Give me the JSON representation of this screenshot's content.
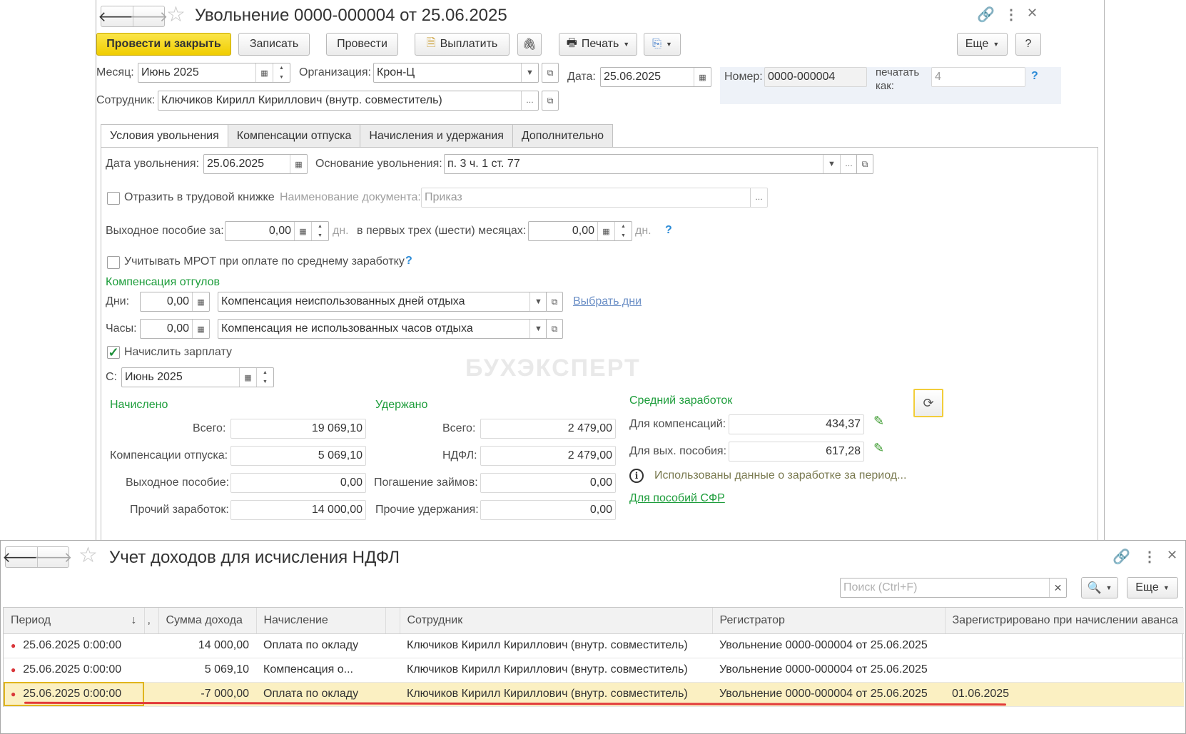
{
  "doc": {
    "title": "Увольнение 0000-000004 от 25.06.2025",
    "toolbar": {
      "post_close": "Провести и закрыть",
      "save": "Записать",
      "post": "Провести",
      "pay": "Выплатить",
      "print": "Печать",
      "more": "Еще",
      "help": "?"
    },
    "header": {
      "month_label": "Месяц:",
      "month_value": "Июнь 2025",
      "org_label": "Организация:",
      "org_value": "Крон-Ц",
      "date_label": "Дата:",
      "date_value": "25.06.2025",
      "number_label": "Номер:",
      "number_value": "0000-000004",
      "print_as_label_1": "печатать",
      "print_as_label_2": "как:",
      "print_as_value": "4",
      "print_as_help": "?",
      "employee_label": "Сотрудник:",
      "employee_value": "Ключиков Кирилл Кириллович (внутр. совместитель)"
    },
    "tabs": [
      "Условия увольнения",
      "Компенсации отпуска",
      "Начисления и удержания",
      "Дополнительно"
    ],
    "conditions": {
      "dismissal_date_label": "Дата увольнения:",
      "dismissal_date_value": "25.06.2025",
      "basis_label": "Основание увольнения:",
      "basis_value": "п. 3 ч. 1 ст. 77",
      "workbook_label": "Отразить в трудовой книжке",
      "workbook_checked": false,
      "doc_name_label": "Наименование документа:",
      "doc_name_value": "Приказ",
      "severance_label": "Выходное пособие за:",
      "severance_value": "0,00",
      "days_unit": "дн.",
      "first_months_label": "в первых трех (шести) месяцах:",
      "first_months_value": "0,00",
      "help": "?",
      "mrot_label": "Учитывать МРОТ при оплате по среднему заработку",
      "mrot_checked": false,
      "comp_section": "Компенсация отгулов",
      "days_label": "Дни:",
      "days_value": "0,00",
      "days_type": "Компенсация неиспользованных дней отдыха",
      "choose_days": "Выбрать дни",
      "hours_label": "Часы:",
      "hours_value": "0,00",
      "hours_type": "Компенсация не использованных часов отдыха",
      "accrue_label": "Начислить зарплату",
      "accrue_checked": true,
      "from_label": "С:",
      "from_value": "Июнь 2025"
    },
    "accrued": {
      "title": "Начислено",
      "total_label": "Всего:",
      "total": "19 069,10",
      "vacation_comp_label": "Компенсации отпуска:",
      "vacation_comp": "5 069,10",
      "severance_label": "Выходное пособие:",
      "severance": "0,00",
      "other_label": "Прочий заработок:",
      "other": "14 000,00"
    },
    "withheld": {
      "title": "Удержано",
      "total_label": "Всего:",
      "total": "2 479,00",
      "ndfl_label": "НДФЛ:",
      "ndfl": "2 479,00",
      "loans_label": "Погашение займов:",
      "loans": "0,00",
      "other_label": "Прочие удержания:",
      "other": "0,00"
    },
    "average": {
      "title": "Средний заработок",
      "comp_label": "Для компенсаций:",
      "comp": "434,37",
      "sev_label": "Для вых. пособия:",
      "sev": "617,28",
      "info_text": "Использованы данные о заработке за период...",
      "sfr_link": "Для пособий СФР"
    },
    "watermark": "БУХЭКСПЕРТ"
  },
  "register": {
    "title": "Учет доходов для исчисления НДФЛ",
    "search_placeholder": "Поиск (Ctrl+F)",
    "more": "Еще",
    "columns": [
      "Период",
      ",",
      "Сумма дохода",
      "Начисление",
      "",
      "Сотрудник",
      "Регистратор",
      "Зарегистрировано при начислении аванса"
    ],
    "sort_indicator": "↓",
    "rows": [
      {
        "period": "25.06.2025 0:00:00",
        "amount": "14 000,00",
        "accrual": "Оплата по окладу",
        "employee": "Ключиков Кирилл Кириллович (внутр. совместитель)",
        "registrar": "Увольнение 0000-000004 от 25.06.2025",
        "advance": ""
      },
      {
        "period": "25.06.2025 0:00:00",
        "amount": "5 069,10",
        "accrual": "Компенсация о...",
        "employee": "Ключиков Кирилл Кириллович (внутр. совместитель)",
        "registrar": "Увольнение 0000-000004 от 25.06.2025",
        "advance": ""
      },
      {
        "period": "25.06.2025 0:00:00",
        "amount": "-7 000,00",
        "accrual": "Оплата по окладу",
        "employee": "Ключиков Кирилл Кириллович (внутр. совместитель)",
        "registrar": "Увольнение 0000-000004 от 25.06.2025",
        "advance": "01.06.2025",
        "selected": true
      }
    ]
  },
  "colors": {
    "primary_button": "#f5d90f",
    "green_label": "#1d9d3b",
    "row_selected": "#fbf0c2",
    "highlight_line": "#e23b3b",
    "link": "#6b8fc6"
  },
  "icons": [
    "back-arrow-icon",
    "forward-arrow-icon",
    "star-icon",
    "link-icon",
    "more-vertical-icon",
    "close-icon",
    "paperclip-icon",
    "printer-icon",
    "calendar-icon",
    "spin-icon",
    "dropdown-icon",
    "open-icon",
    "pencil-icon",
    "refresh-icon",
    "info-icon",
    "search-icon"
  ]
}
